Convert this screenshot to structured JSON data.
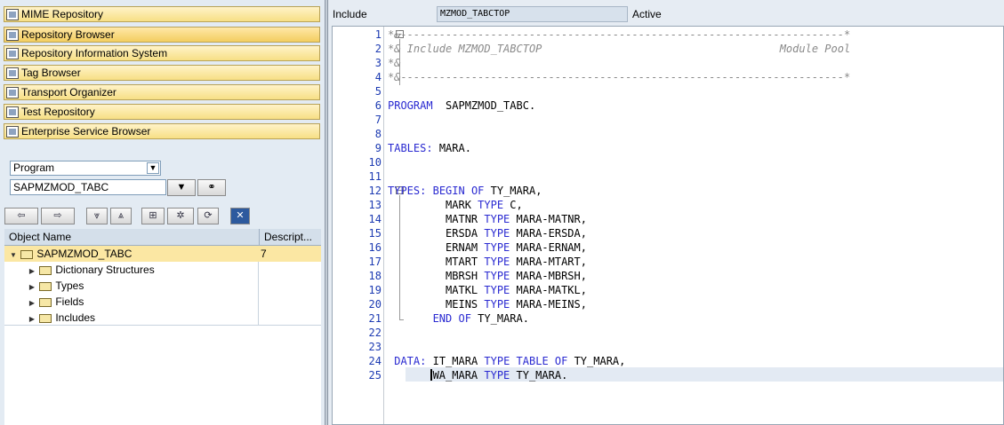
{
  "nav": [
    {
      "label": "MIME Repository",
      "icon": "mime-icon"
    },
    {
      "label": "Repository Browser",
      "icon": "repository-browser-icon"
    },
    {
      "label": "Repository Information System",
      "icon": "info-system-icon"
    },
    {
      "label": "Tag Browser",
      "icon": "tag-icon"
    },
    {
      "label": "Transport Organizer",
      "icon": "truck-icon"
    },
    {
      "label": "Test Repository",
      "icon": "test-icon"
    },
    {
      "label": "Enterprise Service Browser",
      "icon": "service-icon"
    }
  ],
  "object_type": {
    "selected": "Program"
  },
  "object_name": {
    "value": "SAPMZMOD_TABC"
  },
  "tree": {
    "col_name": "Object Name",
    "col_desc": "Descript...",
    "root": {
      "label": "SAPMZMOD_TABC",
      "desc": "7"
    },
    "children": [
      {
        "label": "Dictionary Structures"
      },
      {
        "label": "Types"
      },
      {
        "label": "Fields"
      },
      {
        "label": "Includes"
      }
    ]
  },
  "editor_header": {
    "include_label": "Include",
    "include_name": "MZMOD_TABCTOP",
    "status": "Active"
  },
  "code_lines": [
    "*&---------------------------------------------------------------------*",
    "*& Include MZMOD_TABCTOP                                     Module Pool",
    "*&",
    "*&---------------------------------------------------------------------*",
    "",
    "PROGRAM  SAPMZMOD_TABC.",
    "",
    "",
    "TABLES: MARA.",
    "",
    "",
    "TYPES: BEGIN OF TY_MARA,",
    "         MARK TYPE C,",
    "         MATNR TYPE MARA-MATNR,",
    "         ERSDA TYPE MARA-ERSDA,",
    "         ERNAM TYPE MARA-ERNAM,",
    "         MTART TYPE MARA-MTART,",
    "         MBRSH TYPE MARA-MBRSH,",
    "         MATKL TYPE MARA-MATKL,",
    "         MEINS TYPE MARA-MEINS,",
    "       END OF TY_MARA.",
    "",
    "",
    " DATA: IT_MARA TYPE TABLE OF TY_MARA,",
    "       WA_MARA TYPE TY_MARA."
  ]
}
